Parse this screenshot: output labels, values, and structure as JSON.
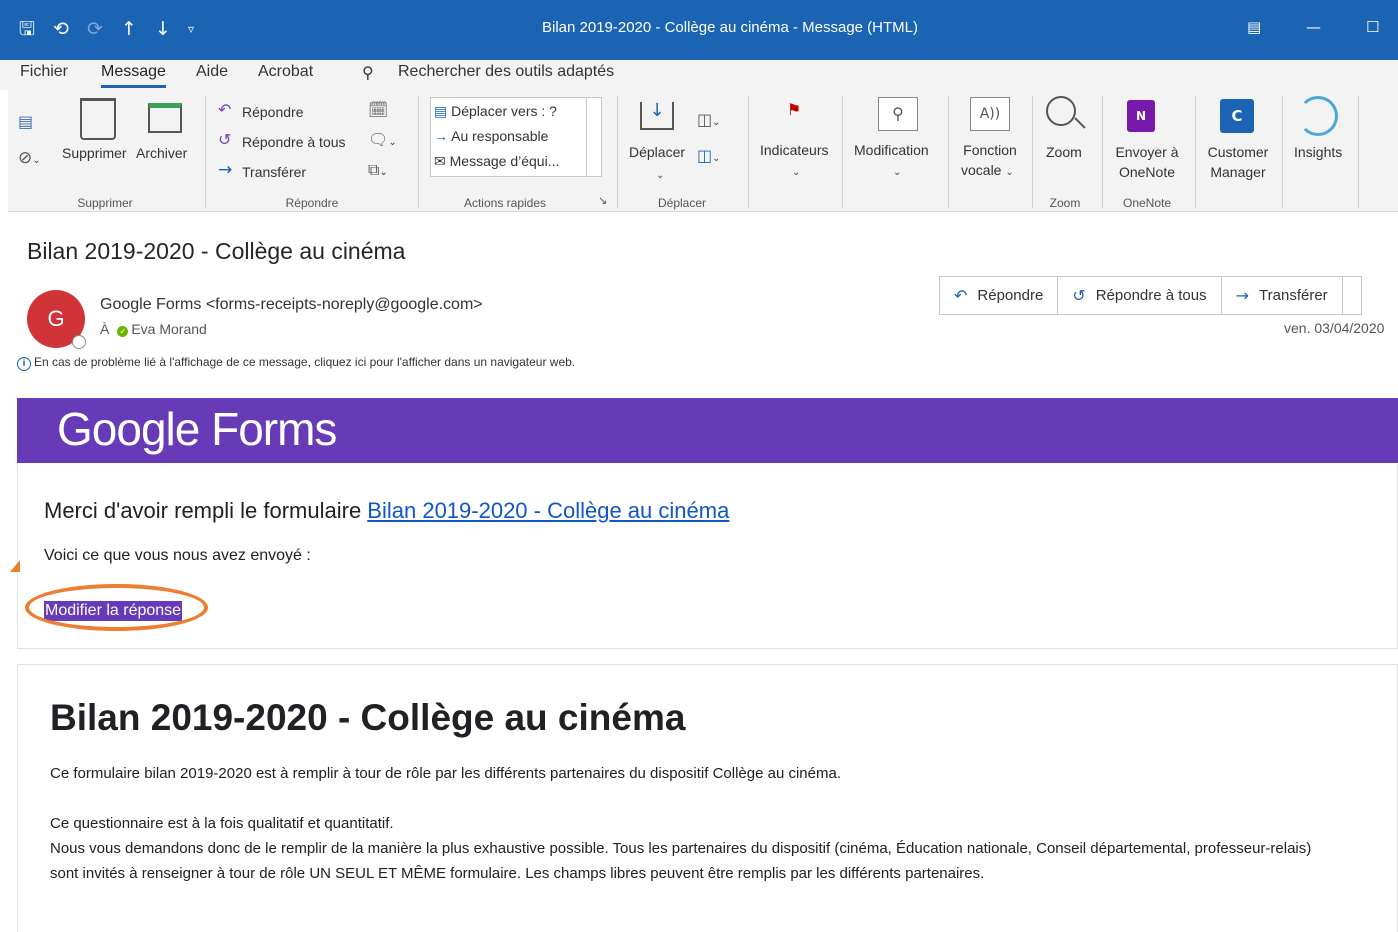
{
  "window": {
    "title": "Bilan 2019-2020 - Collège au cinéma  -  Message (HTML)",
    "qat_icons": [
      "save-icon",
      "undo-icon",
      "redo-icon",
      "up-arrow-icon",
      "down-arrow-icon",
      "customize-icon"
    ]
  },
  "menu": {
    "tabs": [
      "Fichier",
      "Message",
      "Aide",
      "Acrobat"
    ],
    "active": "Message",
    "search": "Rechercher des outils adaptés"
  },
  "ribbon": {
    "supprimer": {
      "delete": "Supprimer",
      "archive": "Archiver",
      "group": "Supprimer"
    },
    "repondre": {
      "reply": "Répondre",
      "reply_all": "Répondre à tous",
      "forward": "Transférer",
      "group": "Répondre"
    },
    "quick_steps": {
      "items": [
        "Déplacer vers : ?",
        "Au responsable",
        "Message d’équi..."
      ],
      "group": "Actions rapides"
    },
    "deplacer": {
      "move": "Déplacer",
      "group": "Déplacer"
    },
    "tags": {
      "label": "Indicateurs"
    },
    "editing": {
      "label": "Modification"
    },
    "voice": {
      "label1": "Fonction",
      "label2": "vocale"
    },
    "zoom": {
      "label": "Zoom",
      "group": "Zoom"
    },
    "onenote": {
      "label1": "Envoyer à",
      "label2": "OneNote",
      "group": "OneNote"
    },
    "customer": {
      "label1": "Customer",
      "label2": "Manager"
    },
    "insights": {
      "label": "Insights"
    }
  },
  "message": {
    "subject": "Bilan 2019-2020 - Collège au cinéma",
    "avatar_letter": "G",
    "from": "Google Forms <forms-receipts-noreply@google.com>",
    "to_prefix": "À",
    "to": "Eva Morand",
    "info": "En cas de problème lié à l'affichage de ce message, cliquez ici pour l'afficher dans un navigateur web.",
    "actions": {
      "reply": "Répondre",
      "reply_all": "Répondre à tous",
      "forward": "Transférer"
    },
    "date": "ven. 03/04/2020"
  },
  "body": {
    "logo": "Google Forms",
    "thanks_prefix": "Merci d'avoir rempli le formulaire ",
    "form_link": "Bilan 2019-2020 - Collège au cinéma",
    "sent_text": "Voici ce que vous nous avez envoyé :",
    "edit_link": "Modifier la réponse",
    "form_title": "Bilan 2019-2020 - Collège au cinéma",
    "para1": "Ce formulaire bilan 2019-2020 est à remplir à tour de rôle par les différents partenaires du dispositif Collège au cinéma.",
    "para2": "Ce questionnaire est à la fois qualitatif et quantitatif.",
    "para3": "Nous vous demandons donc de le remplir de la manière la plus exhaustive possible. Tous les partenaires du dispositif (cinéma, Éducation nationale, Conseil départemental, professeur-relais) sont invités à renseigner à tour de rôle UN SEUL ET MÊME formulaire. Les champs libres peuvent être remplis par les différents partenaires."
  },
  "colors": {
    "titlebar": "#1a64b3",
    "forms_purple": "#673ab7",
    "annotation": "#ed7d31",
    "avatar": "#d13438"
  }
}
